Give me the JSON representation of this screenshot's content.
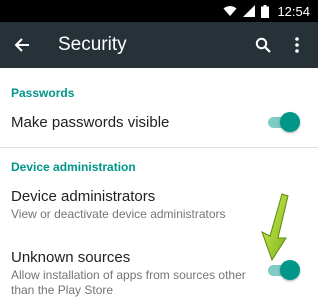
{
  "status_bar": {
    "time": "12:54",
    "icons": [
      "wifi-icon",
      "signal-icon",
      "battery-icon"
    ]
  },
  "app_bar": {
    "title": "Security",
    "background": "#263238",
    "icons": [
      "back-arrow-icon",
      "search-icon",
      "overflow-menu-icon"
    ]
  },
  "sections": [
    {
      "header": "Passwords",
      "items": [
        {
          "title": "Make passwords visible",
          "toggle": true
        }
      ]
    },
    {
      "header": "Device administration",
      "items": [
        {
          "title": "Device administrators",
          "summary": "View or deactivate device administrators"
        },
        {
          "title": "Unknown sources",
          "summary_line1": "Allow installation of apps from sources other",
          "summary_line2": "than the Play Store",
          "toggle": true
        }
      ]
    }
  ],
  "colors": {
    "accent": "#009688",
    "toggle_track": "#80cbc4",
    "annotation_arrow": "#9ccc1e"
  }
}
